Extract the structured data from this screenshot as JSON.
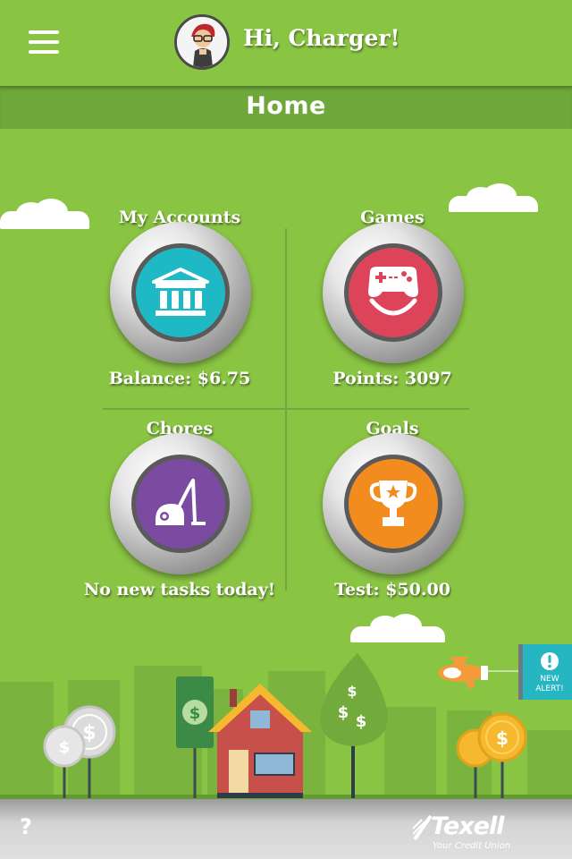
{
  "header": {
    "menu_icon": "hamburger-menu-icon",
    "avatar_icon": "character-avatar",
    "greeting": "Hi, Charger!"
  },
  "page": {
    "title": "Home"
  },
  "tiles": [
    {
      "title": "My Accounts",
      "subtitle": "Balance: $6.75",
      "icon": "bank-icon",
      "color": "#1fb9c5"
    },
    {
      "title": "Games",
      "subtitle": "Points: 3097",
      "icon": "game-controller-icon",
      "color": "#dd4459"
    },
    {
      "title": "Chores",
      "subtitle": "No new tasks today!",
      "icon": "vacuum-cleaner-icon",
      "color": "#7b4aa1"
    },
    {
      "title": "Goals",
      "subtitle": "Test:  $50.00",
      "icon": "trophy-icon",
      "color": "#f28c1e"
    }
  ],
  "alert": {
    "line1": "NEW",
    "line2": "ALERT!",
    "icon": "exclamation-icon",
    "color": "#26b6c2"
  },
  "footer": {
    "help_label": "?",
    "brand_name": "Texell",
    "brand_tagline": "Your Credit Union"
  },
  "colors": {
    "background": "#8ac443",
    "title_bar": "#6fa83a",
    "footer": "#d4d4d4"
  }
}
